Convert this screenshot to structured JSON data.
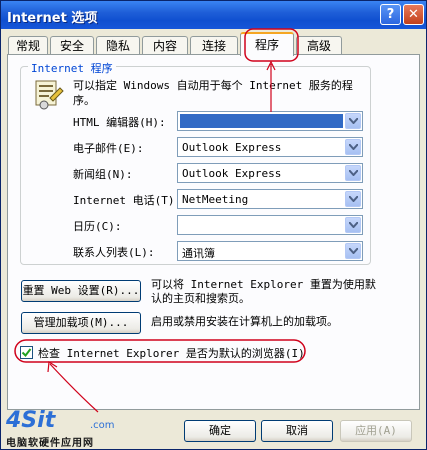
{
  "window": {
    "title": "Internet 选项",
    "help_glyph": "?",
    "close_glyph": "✕"
  },
  "tabs": [
    {
      "label": "常规"
    },
    {
      "label": "安全"
    },
    {
      "label": "隐私"
    },
    {
      "label": "内容"
    },
    {
      "label": "连接"
    },
    {
      "label": "程序",
      "active": true
    },
    {
      "label": "高级"
    }
  ],
  "programs": {
    "group_title": "Internet 程序",
    "icon": "programs-icon",
    "description_line1": "可以指定 Windows 自动用于每个 Internet 服务的程序。",
    "description_line2": "序。",
    "rows": [
      {
        "label": "HTML 编辑器(H):",
        "value": ""
      },
      {
        "label": "电子邮件(E):",
        "value": "Outlook Express"
      },
      {
        "label": "新闻组(N):",
        "value": "Outlook Express"
      },
      {
        "label": "Internet 电话(T):",
        "value": "NetMeeting"
      },
      {
        "label": "日历(C):",
        "value": ""
      },
      {
        "label": "联系人列表(L):",
        "value": "通讯簿"
      }
    ]
  },
  "reset_web": {
    "button": "重置 Web 设置(R)...",
    "note_line1": "可以将 Internet Explorer 重置为使用默",
    "note_line2": "认的主页和搜索页。"
  },
  "addons": {
    "button": "管理加载项(M)...",
    "note": "启用或禁用安装在计算机上的加载项。"
  },
  "default_check": {
    "checked": true,
    "label": "检查 Internet Explorer 是否为默认的浏览器(I)"
  },
  "footer": {
    "ok": "确定",
    "cancel": "取消",
    "apply": "应用(A)"
  },
  "watermark": {
    "brand": "4Sit",
    "domain": ".com",
    "tagline": "电脑软硬件应用网"
  },
  "colors": {
    "annotation": "#d0021b",
    "titlebar": "#1f5fd8",
    "selection": "#316ac5"
  }
}
